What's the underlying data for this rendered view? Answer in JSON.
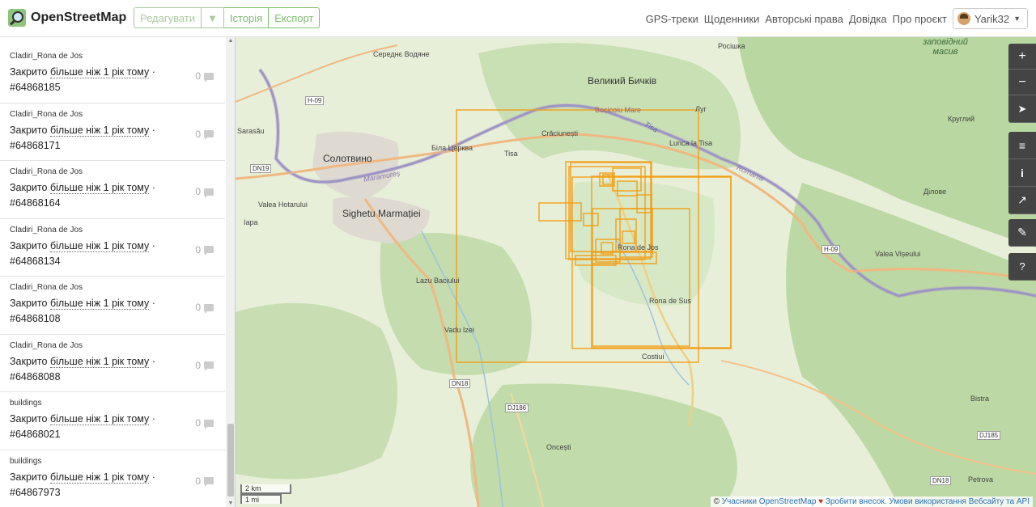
{
  "header": {
    "logo_text": "OpenStreetMap",
    "edit_label": "Редагувати",
    "edit_caret": "▼",
    "history_label": "Історія",
    "export_label": "Експорт",
    "nav": {
      "gps": "GPS-треки",
      "diaries": "Щоденники",
      "copyright": "Авторські права",
      "help": "Довідка",
      "about": "Про проєкт"
    },
    "user": {
      "name": "Yarik32",
      "caret": "▼"
    }
  },
  "sidebar": {
    "items": [
      {
        "title": "Cladiri_Rona de Jos",
        "status": "Закрито",
        "date": "більше ніж 1 рік тому",
        "sep": "·",
        "id": "#64868185",
        "comments": "0"
      },
      {
        "title": "Cladiri_Rona de Jos",
        "status": "Закрито",
        "date": "більше ніж 1 рік тому",
        "sep": "·",
        "id": "#64868171",
        "comments": "0"
      },
      {
        "title": "Cladiri_Rona de Jos",
        "status": "Закрито",
        "date": "більше ніж 1 рік тому",
        "sep": "·",
        "id": "#64868164",
        "comments": "0"
      },
      {
        "title": "Cladiri_Rona de Jos",
        "status": "Закрито",
        "date": "більше ніж 1 рік тому",
        "sep": "·",
        "id": "#64868134",
        "comments": "0"
      },
      {
        "title": "Cladiri_Rona de Jos",
        "status": "Закрито",
        "date": "більше ніж 1 рік тому",
        "sep": "·",
        "id": "#64868108",
        "comments": "0"
      },
      {
        "title": "Cladiri_Rona de Jos",
        "status": "Закрито",
        "date": "більше ніж 1 рік тому",
        "sep": "·",
        "id": "#64868088",
        "comments": "0"
      },
      {
        "title": "buildings",
        "status": "Закрито",
        "date": "більше ніж 1 рік тому",
        "sep": "·",
        "id": "#64868021",
        "comments": "0"
      },
      {
        "title": "buildings",
        "status": "Закрито",
        "date": "більше ніж 1 рік тому",
        "sep": "·",
        "id": "#64867973",
        "comments": "0"
      }
    ]
  },
  "map": {
    "labels": {
      "veliky_bychkiv": "Великий Бичків",
      "solotvyno": "Солотвино",
      "sighetu": "Sighetu Marmației",
      "serednye": "Середнє Водяне",
      "bila_tserkva": "Біла Церква",
      "craciunesti": "Crăciunești",
      "tisa": "Tisa",
      "lunca": "Lunca la Tisa",
      "lug": "Луг",
      "rosishka": "Росішка",
      "zapovidny": "заповідний масив",
      "kruhlyi": "Круглий",
      "dilove": "Ділове",
      "valea_viseului": "Valea Vișeului",
      "sarasau": "Sarasău",
      "valea_hotarului": "Valea Hotarului",
      "iapa": "Iapa",
      "lazu": "Lazu Baciului",
      "vadu_izei": "Vadu Izei",
      "rona_de_sus": "Rona de Sus",
      "rona_de_jos": "Rona de Jos",
      "costiui": "Costiui",
      "oncesti": "Oncești",
      "bistra": "Bistra",
      "petrova": "Petrova",
      "bocicoiu": "Bocicoiu Mare",
      "tisa_river": "Tisa",
      "maramures": "Maramureș",
      "romania": "Romania"
    },
    "shields": {
      "h09a": "H-09",
      "h09b": "H-09",
      "dn19": "DN19",
      "dn18a": "DN18",
      "dj186": "DJ186",
      "dj185": "DJ185",
      "dn18b": "DN18"
    },
    "controls": {
      "zoom_in": "+",
      "zoom_out": "−",
      "locate": "➤",
      "layers": "≡",
      "info": "i",
      "share": "↗",
      "note": "✎",
      "query": "?"
    },
    "scale": {
      "metric": "2 km",
      "imperial": "1 mi"
    },
    "attribution": {
      "prefix": "©",
      "contributors": "Учасники OpenStreetMap",
      "heart": "♥",
      "donate": "Зробити внесок.",
      "terms": "Умови використання Вебсайту та API"
    },
    "colors": {
      "accent": "#7ebc6f",
      "bbox": "#f39c12"
    }
  }
}
